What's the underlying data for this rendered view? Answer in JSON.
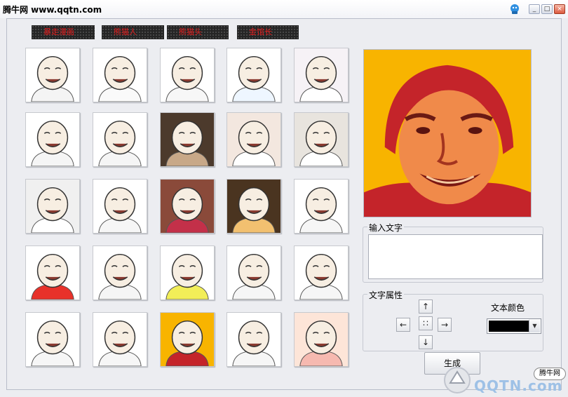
{
  "window": {
    "title": "腾牛网 www.qqtn.com",
    "buttons": {
      "minimize": "_",
      "maximize": "□",
      "close": "×"
    }
  },
  "tabs": [
    {
      "label": "暴走漫画"
    },
    {
      "label": "熊猫人"
    },
    {
      "label": "熊猫头"
    },
    {
      "label": "金馆长"
    }
  ],
  "faces": [
    {
      "icon": "meme-face-icon"
    },
    {
      "icon": "meme-face-icon"
    },
    {
      "icon": "meme-face-icon"
    },
    {
      "icon": "meme-face-icon"
    },
    {
      "icon": "meme-face-icon"
    },
    {
      "icon": "meme-face-icon"
    },
    {
      "icon": "meme-face-icon"
    },
    {
      "icon": "meme-face-icon"
    },
    {
      "icon": "meme-face-icon"
    },
    {
      "icon": "meme-face-icon"
    },
    {
      "icon": "meme-face-icon"
    },
    {
      "icon": "meme-face-icon"
    },
    {
      "icon": "meme-face-icon"
    },
    {
      "icon": "meme-face-icon"
    },
    {
      "icon": "meme-face-icon"
    },
    {
      "icon": "meme-face-icon"
    },
    {
      "icon": "meme-face-icon"
    },
    {
      "icon": "meme-face-icon"
    },
    {
      "icon": "meme-face-icon"
    },
    {
      "icon": "meme-face-icon"
    },
    {
      "icon": "meme-face-icon"
    },
    {
      "icon": "meme-face-icon"
    },
    {
      "icon": "meme-face-icon"
    },
    {
      "icon": "meme-face-icon"
    },
    {
      "icon": "meme-face-icon"
    }
  ],
  "input_text": {
    "label": "输入文字",
    "value": ""
  },
  "text_props": {
    "label": "文字属性",
    "up": "↑",
    "down": "↓",
    "left": "←",
    "right": "→",
    "center": "∷"
  },
  "text_color": {
    "label": "文本颜色",
    "value": "#000000"
  },
  "generate_button": "生成",
  "watermark": {
    "brand": "腾牛网",
    "site": "QQTN.com"
  },
  "colors": {
    "preview_bg": "#f8b400",
    "tab_text": "#e21c1c",
    "preview_red": "#c4242a"
  }
}
